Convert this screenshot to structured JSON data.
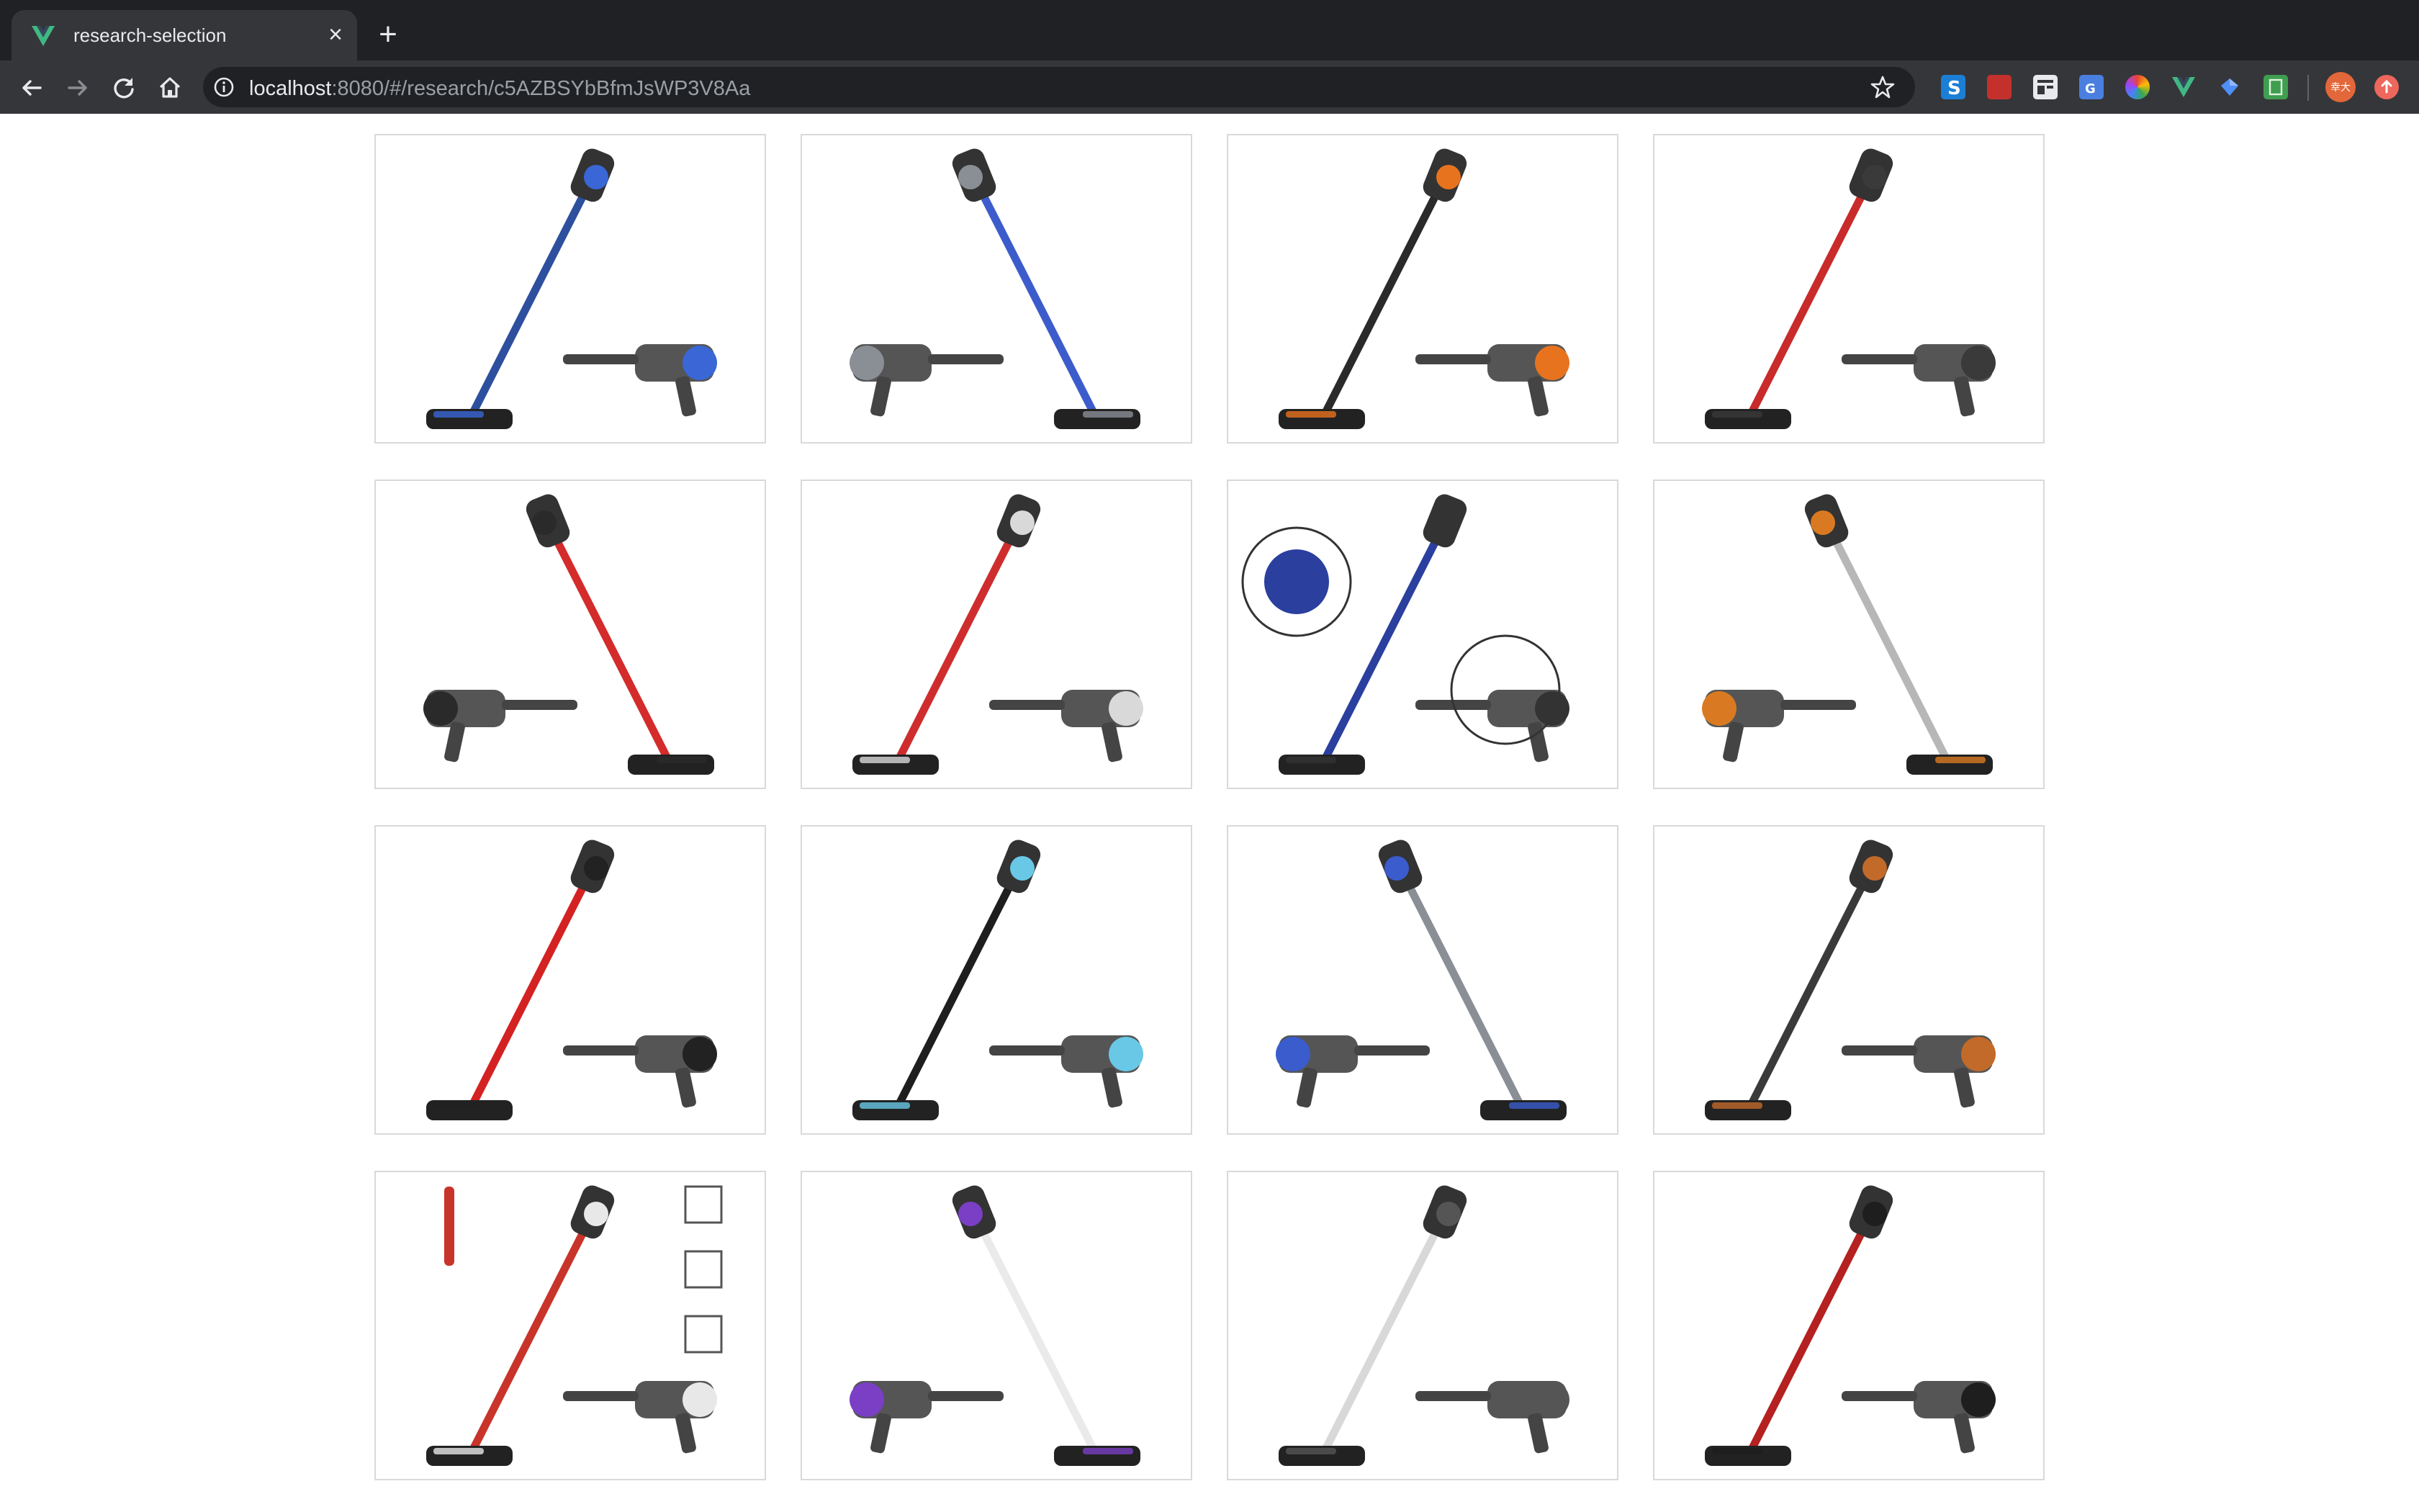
{
  "browser": {
    "tab": {
      "title": "research-selection",
      "favicon": "vue-icon"
    },
    "url": {
      "host": "localhost",
      "rest": ":8080/#/research/c5AZBSYbBfmJsWP3V8Aa"
    },
    "profile": {
      "avatar_text": "幸大"
    },
    "extensions": [
      "s-extension-icon",
      "red-book-icon",
      "doc-extension-icon",
      "translate-icon",
      "color-wheel-icon",
      "vue-devtools-icon",
      "blue-diamond-icon",
      "green-note-icon"
    ]
  },
  "products": [
    {
      "color": "#2d4f9e",
      "accent": "#3a66d6",
      "style": "stick-with-handheld"
    },
    {
      "color": "#3d5ccc",
      "accent": "#8a8f96",
      "style": "stick-with-handheld"
    },
    {
      "color": "#2a2a2a",
      "accent": "#e8731e",
      "style": "stick-with-handheld"
    },
    {
      "color": "#c92a2a",
      "accent": "#3a3a3a",
      "style": "stick-with-handheld"
    },
    {
      "color": "#d42b2b",
      "accent": "#2a2a2a",
      "style": "stick-with-handheld"
    },
    {
      "color": "#cf2d2d",
      "accent": "#d9d9d9",
      "style": "stick-with-handheld"
    },
    {
      "color": "#2a3f9e",
      "accent": "#333333",
      "style": "stick-with-zoom-circles"
    },
    {
      "color": "#b7b7b7",
      "accent": "#d97a22",
      "style": "stick-with-handheld"
    },
    {
      "color": "#d42222",
      "accent": "#222222",
      "style": "stick-with-handheld"
    },
    {
      "color": "#1e1e1e",
      "accent": "#68c8e6",
      "style": "stick-with-handheld"
    },
    {
      "color": "#8a8f96",
      "accent": "#3a5ccc",
      "style": "stick-with-handheld"
    },
    {
      "color": "#3a3a3a",
      "accent": "#c26a2a",
      "style": "stick-with-handheld"
    },
    {
      "color": "#c8342a",
      "accent": "#e8e8e8",
      "style": "stick-with-infographic"
    },
    {
      "color": "#eaeaea",
      "accent": "#7a3fc4",
      "style": "stick-with-handheld"
    },
    {
      "color": "#d8d8d8",
      "accent": "#555555",
      "style": "stick-with-handheld"
    },
    {
      "color": "#b52020",
      "accent": "#1e1e1e",
      "style": "stick-with-handheld"
    }
  ]
}
